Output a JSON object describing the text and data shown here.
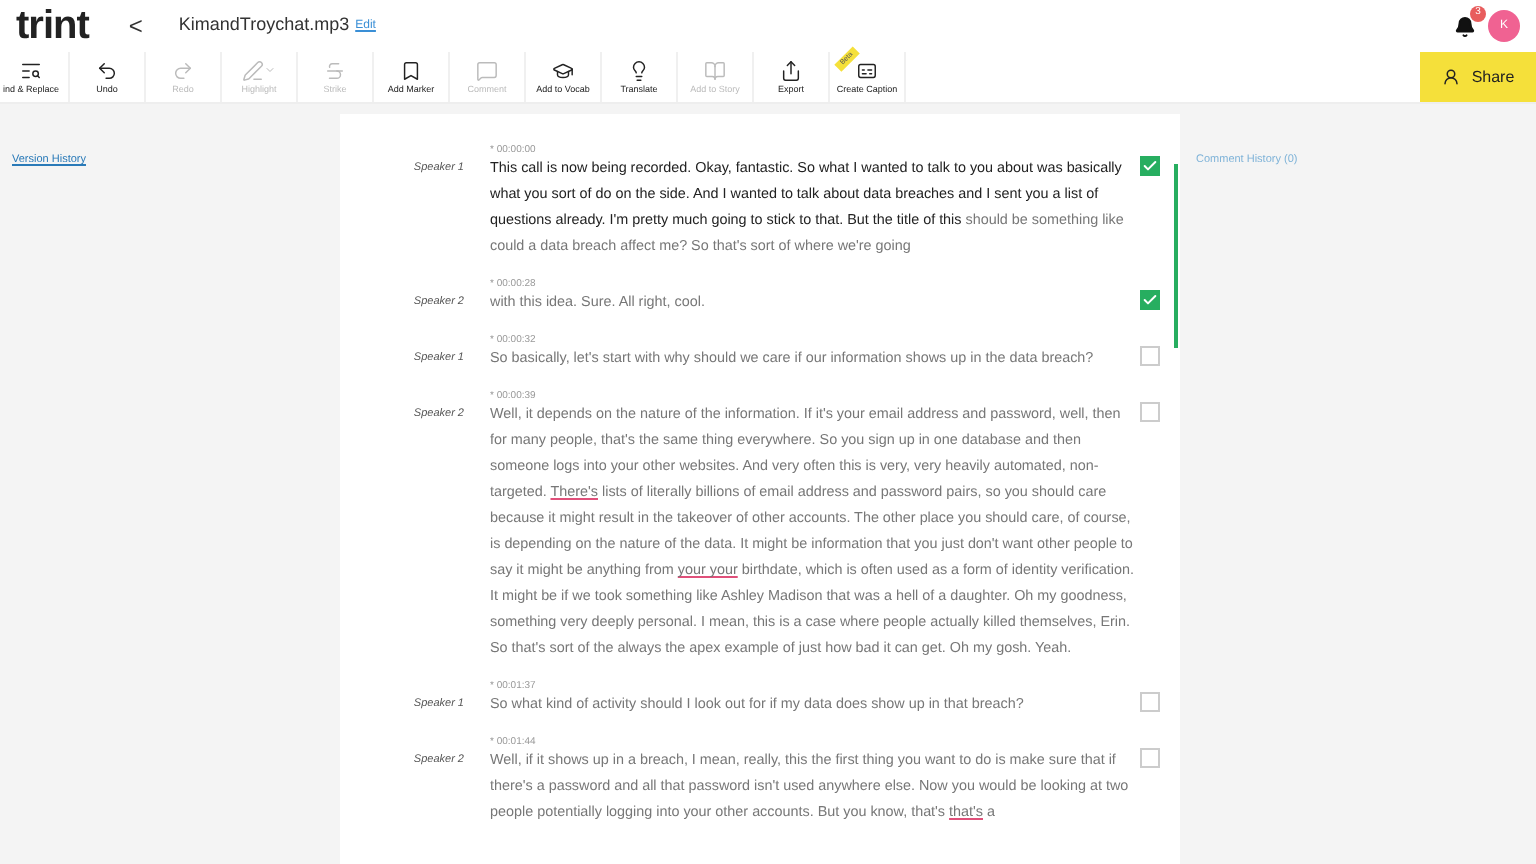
{
  "header": {
    "logo": "trint",
    "back": "<",
    "file_name": "KimandTroychat.mp3",
    "edit_link": "Edit",
    "notifications": "3",
    "avatar": "K"
  },
  "toolbar": [
    {
      "kind": "find",
      "label": "ind & Replace",
      "disabled": false
    },
    {
      "kind": "undo",
      "label": "Undo",
      "disabled": false
    },
    {
      "kind": "redo",
      "label": "Redo",
      "disabled": true
    },
    {
      "kind": "highlight",
      "label": "Highlight",
      "disabled": true
    },
    {
      "kind": "strike",
      "label": "Strike",
      "disabled": true
    },
    {
      "kind": "marker",
      "label": "Add Marker",
      "disabled": false
    },
    {
      "kind": "comment",
      "label": "Comment",
      "disabled": true
    },
    {
      "kind": "vocab",
      "label": "Add to Vocab",
      "disabled": false
    },
    {
      "kind": "translate",
      "label": "Translate",
      "disabled": false
    },
    {
      "kind": "story",
      "label": "Add to Story",
      "disabled": true
    },
    {
      "kind": "export",
      "label": "Export",
      "disabled": false
    },
    {
      "kind": "caption",
      "label": "Create Caption",
      "disabled": false,
      "ribbon": "Beta"
    }
  ],
  "share_button": "Share",
  "version_history": "Version History",
  "comment_history": "Comment History (0)",
  "paragraphs": [
    {
      "speaker": "Speaker 1",
      "time": "* 00:00:00",
      "checked": true,
      "segments": [
        {
          "text": "This call is now being recorded. Okay, fantastic. So what I wanted to talk to you about was basically what you sort of do on the side. And I wanted to talk about data breaches and I sent you a list of questions already. I'm pretty much going to stick to that. But the title of this ",
          "played": true,
          "flagged": false
        },
        {
          "text": "should be something like could a data breach affect me? So that's sort of where we're going",
          "played": false,
          "flagged": false
        }
      ]
    },
    {
      "speaker": "Speaker 2",
      "time": "* 00:00:28",
      "checked": true,
      "segments": [
        {
          "text": "with this idea. Sure. All right, cool.",
          "played": false,
          "flagged": false
        }
      ]
    },
    {
      "speaker": "Speaker 1",
      "time": "* 00:00:32",
      "checked": false,
      "segments": [
        {
          "text": "So basically, let's start with why should we care if our information shows up in the data breach?",
          "played": false,
          "flagged": false
        }
      ]
    },
    {
      "speaker": "Speaker 2",
      "time": "* 00:00:39",
      "checked": false,
      "segments": [
        {
          "text": "Well, it depends on the nature of the information. If it's your email address and password, well, then for many people, that's the same thing everywhere. So you sign up in one database and then someone logs into your other websites. And very often this is very, very heavily automated, non-targeted. ",
          "played": false,
          "flagged": false
        },
        {
          "text": "There's",
          "played": false,
          "flagged": true
        },
        {
          "text": " lists of literally billions of email address and password pairs, so you should care because it might result in the takeover of other accounts. The other place you should care, of course, is depending on the nature of the data. It might be information that you just don't want other people to say it might be anything from ",
          "played": false,
          "flagged": false
        },
        {
          "text": "your your",
          "played": false,
          "flagged": true
        },
        {
          "text": " birthdate, which is often used as a form of identity verification. It might be if we took something like Ashley Madison that was a hell of a daughter. Oh my goodness, something very deeply personal. I mean, this is a case where people actually killed themselves, Erin. So that's sort of the always the apex example of just how bad it can get. Oh my gosh. Yeah.",
          "played": false,
          "flagged": false
        }
      ]
    },
    {
      "speaker": "Speaker 1",
      "time": "* 00:01:37",
      "checked": false,
      "segments": [
        {
          "text": "So what kind of activity should I look out for if my data does show up in that breach?",
          "played": false,
          "flagged": false
        }
      ]
    },
    {
      "speaker": "Speaker 2",
      "time": "* 00:01:44",
      "checked": false,
      "segments": [
        {
          "text": "Well, if it shows up in a breach, I mean, really, this the first thing you want to do is make sure that if there's a password and all that password isn't used anywhere else. Now you would be looking at two people potentially logging into your other accounts. But you know, that's ",
          "played": false,
          "flagged": false
        },
        {
          "text": "that's",
          "played": false,
          "flagged": true
        },
        {
          "text": " a",
          "played": false,
          "flagged": false
        }
      ]
    }
  ]
}
